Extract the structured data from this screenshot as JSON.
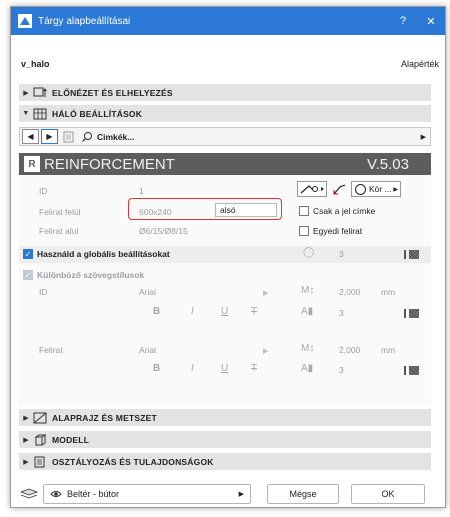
{
  "titlebar": {
    "title": "Tárgy alapbeállításai",
    "help": "?",
    "close": "✕"
  },
  "header": {
    "object_name": "v_halo",
    "defaults_label": "Alapérték"
  },
  "sections": {
    "preview": "ELŐNÉZET ÉS ELHELYEZÉS",
    "mesh": "HÁLÓ BEÁLLÍTÁSOK",
    "floorplan": "ALAPRAJZ ÉS METSZET",
    "model": "MODELL",
    "classification": "OSZTÁLYOZÁS ÉS TULAJDONSÁGOK"
  },
  "navbar": {
    "page_label": "Cimkék..."
  },
  "banner": {
    "title": "REINFORCEMENT",
    "version": "V.5.03",
    "logo": "R"
  },
  "params": {
    "id_label": "ID",
    "id_value": "1",
    "label_top_label": "Felirat felül",
    "label_top_value": "600x240",
    "label_top_input": "alsó",
    "label_bottom_label": "Felirat alul",
    "label_bottom_value": "Ø6/15/Ø8/15",
    "shape_dropdown": "Kör ...",
    "only_tag_label": "Csak a jel címke",
    "custom_label": "Egyedi felirat",
    "use_global": "Használd a globális beállításokat",
    "global_number": "3",
    "different_styles": "Különböző szövegstílusok",
    "row1_label": "ID",
    "row2_label": "Felirat",
    "font": "Arial",
    "font_size": "2,000",
    "unit": "mm",
    "pen_number": "3",
    "bold": "B",
    "italic": "I",
    "underline": "U",
    "strike": "T"
  },
  "footer": {
    "layer": "Beltér - bútor",
    "cancel": "Mégse",
    "ok": "OK"
  },
  "colors": {
    "accent": "#2b78d6",
    "highlight_border": "#e0363b",
    "banner": "#5d5d5d"
  }
}
